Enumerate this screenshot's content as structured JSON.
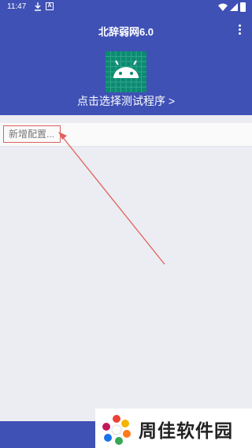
{
  "status_bar": {
    "time": "11:47",
    "icons": [
      "download-icon",
      "a-notification-icon",
      "wifi-icon",
      "signal-icon",
      "battery-icon"
    ]
  },
  "app_bar": {
    "title": "北辞弱网6.0",
    "menu_icon": "overflow-menu-icon",
    "app_icon": "android-app-icon",
    "select_prompt": "点击选择测试程序 >"
  },
  "config": {
    "new_config_label": "新增配置..."
  },
  "watermark": {
    "text": "周佳软件园"
  },
  "colors": {
    "primary": "#3f51b5",
    "icon_bg": "#0c8a72",
    "annotation_red": "#e0615f",
    "background": "#ecedf2"
  }
}
